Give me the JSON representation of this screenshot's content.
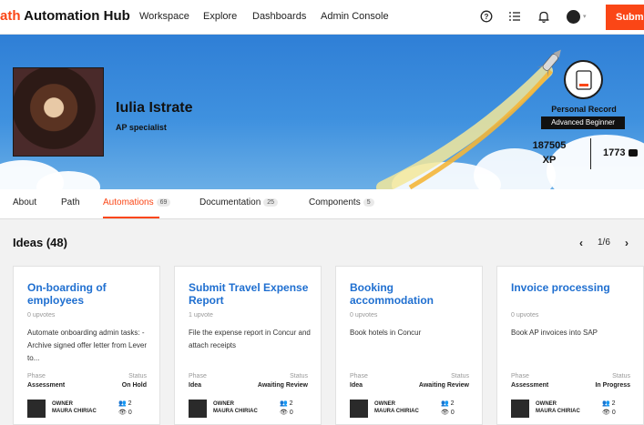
{
  "app": {
    "brand_prefix": "ath",
    "brand_name": "Automation Hub"
  },
  "nav": {
    "items": [
      "Workspace",
      "Explore",
      "Dashboards",
      "Admin Console"
    ]
  },
  "header": {
    "submit_label": "Submi"
  },
  "profile": {
    "name": "Iulia Istrate",
    "role": "AP specialist",
    "record_label": "Personal Record",
    "level": "Advanced Beginner",
    "xp_value": "187505",
    "xp_label": "XP",
    "count_value": "1773"
  },
  "tabs": [
    {
      "label": "About",
      "count": ""
    },
    {
      "label": "Path",
      "count": ""
    },
    {
      "label": "Automations",
      "count": "69"
    },
    {
      "label": "Documentation",
      "count": "25"
    },
    {
      "label": "Components",
      "count": "5"
    }
  ],
  "ideas": {
    "title": "Ideas (48)",
    "page": "1/6"
  },
  "cards": [
    {
      "title": "On-boarding of employees",
      "upvotes": "0 upvotes",
      "description": "Automate onboarding admin tasks: - Archive signed offer letter from Lever to...",
      "phase_label": "Phase",
      "phase": "Assessment",
      "status_label": "Status",
      "status": "On Hold",
      "owner_label": "OWNER",
      "owner_name": "MAURA CHIRIAC",
      "people": "2",
      "views": "0"
    },
    {
      "title": "Submit Travel Expense Report",
      "upvotes": "1 upvote",
      "description": "File the expense report in Concur and attach receipts",
      "phase_label": "Phase",
      "phase": "Idea",
      "status_label": "Status",
      "status": "Awaiting Review",
      "owner_label": "OWNER",
      "owner_name": "MAURA CHIRIAC",
      "people": "2",
      "views": "0"
    },
    {
      "title": "Booking accommodation",
      "upvotes": "0 upvotes",
      "description": "Book hotels in Concur",
      "phase_label": "Phase",
      "phase": "Idea",
      "status_label": "Status",
      "status": "Awaiting Review",
      "owner_label": "OWNER",
      "owner_name": "MAURA CHIRIAC",
      "people": "2",
      "views": "0"
    },
    {
      "title": "Invoice processing",
      "upvotes": "0 upvotes",
      "description": "Book AP invoices into SAP",
      "phase_label": "Phase",
      "phase": "Assessment",
      "status_label": "Status",
      "status": "In Progress",
      "owner_label": "OWNER",
      "owner_name": "MAURA CHIRIAC",
      "people": "2",
      "views": "0"
    }
  ],
  "icons": {
    "help": "help-circle-icon",
    "tasks": "task-list-icon",
    "notifications": "bell-icon",
    "pager_prev": "chevron-left-icon",
    "pager_next": "chevron-right-icon",
    "people": "people-icon",
    "views": "eye-icon"
  },
  "colors": {
    "accent": "#fa4616",
    "link": "#1f6fd0",
    "banner": "#3f91df"
  }
}
